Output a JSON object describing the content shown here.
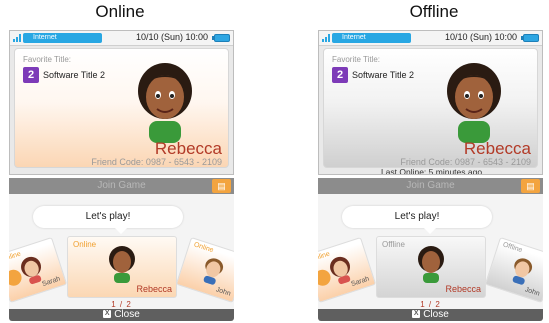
{
  "headings": {
    "online": "Online",
    "offline": "Offline"
  },
  "status_bar": {
    "connection": "Internet",
    "date_time": "10/10 (Sun) 10:00"
  },
  "profile": {
    "favorite_label": "Favorite Title:",
    "title_number": "2",
    "title_name": "Software Title 2",
    "name": "Rebecca",
    "friend_code": "Friend Code: 0987 - 6543 - 2109"
  },
  "offline_extra": {
    "last_online": "Last Online: 5 minutes ago"
  },
  "bottom": {
    "join_label": "Join Game",
    "message": "Let's play!",
    "page_indicator": "1 / 2",
    "close_label": "Close"
  },
  "online_cards": {
    "left": {
      "status": "Online",
      "name": "Sarah"
    },
    "center": {
      "status": "Online",
      "name": "Rebecca"
    },
    "right": {
      "status": "Online",
      "name": "John"
    }
  },
  "offline_cards": {
    "left": {
      "status": "Online",
      "name": "Sarah"
    },
    "center": {
      "status": "Offline",
      "name": "Rebecca"
    },
    "right": {
      "status": "Offline",
      "name": "John"
    }
  },
  "colors": {
    "accent_orange": "#f3a43f",
    "name_red": "#b23a27",
    "badge_purple": "#7d3bb8",
    "status_blue": "#28a7e3"
  }
}
